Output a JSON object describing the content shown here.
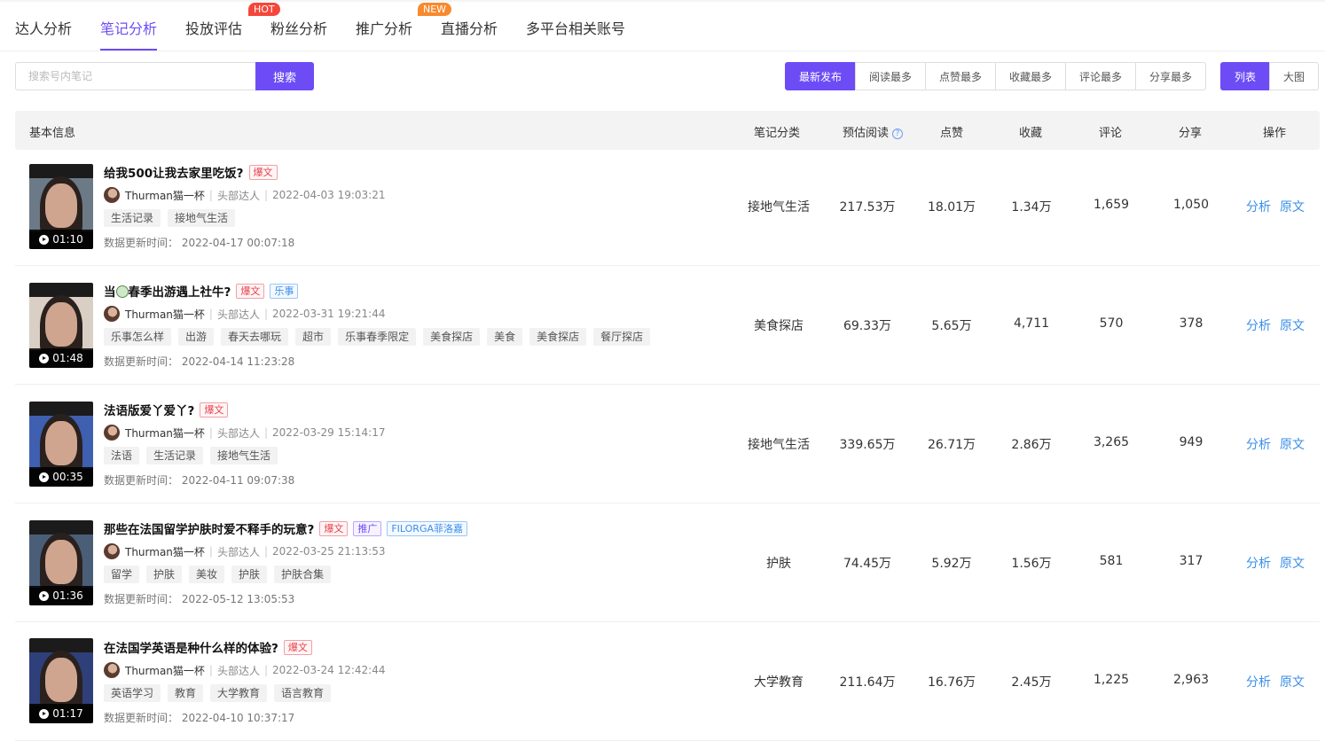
{
  "nav": {
    "tabs": [
      {
        "label": "达人分析"
      },
      {
        "label": "笔记分析"
      },
      {
        "label": "投放评估"
      },
      {
        "label": "粉丝分析"
      },
      {
        "label": "推广分析"
      },
      {
        "label": "直播分析"
      },
      {
        "label": "多平台相关账号"
      }
    ],
    "active_tab": "笔记分析",
    "badge_hot": "HOT",
    "badge_new": "NEW",
    "accent_color": "#6d4cf6"
  },
  "search": {
    "placeholder": "搜索号内笔记",
    "value": "",
    "button_label": "搜索"
  },
  "sort": {
    "options": [
      "最新发布",
      "阅读最多",
      "点赞最多",
      "收藏最多",
      "评论最多",
      "分享最多"
    ],
    "active": "最新发布"
  },
  "view": {
    "options": [
      "列表",
      "大图"
    ],
    "active": "列表"
  },
  "table": {
    "headers": {
      "basic": "基本信息",
      "category": "笔记分类",
      "reads": "预估阅读",
      "likes": "点赞",
      "collects": "收藏",
      "comments": "评论",
      "shares": "分享",
      "actions": "操作"
    },
    "help_icon": "question-circle-icon",
    "rows": [
      {
        "duration": "01:10",
        "title": "给我500让我去家里吃饭?",
        "tags": [
          {
            "text": "爆文",
            "color": "red"
          }
        ],
        "author": "Thurman猫一杯",
        "level": "头部达人",
        "published": "2022-04-03 19:03:21",
        "keywords": [
          "生活记录",
          "接地气生活"
        ],
        "updated_label": "数据更新时间：",
        "updated": "2022-04-17 00:07:18",
        "category": "接地气生活",
        "reads": "217.53万",
        "likes": "18.01万",
        "collects": "1.34万",
        "comments": "1,659",
        "shares": "1,050",
        "action_analyze": "分析",
        "action_original": "原文"
      },
      {
        "duration": "01:48",
        "title_prefix": "当",
        "title": "春季出游遇上社牛?",
        "tags": [
          {
            "text": "爆文",
            "color": "red"
          },
          {
            "text": "乐事",
            "color": "blue"
          }
        ],
        "author": "Thurman猫一杯",
        "level": "头部达人",
        "published": "2022-03-31 19:21:44",
        "keywords": [
          "乐事怎么样",
          "出游",
          "春天去哪玩",
          "超市",
          "乐事春季限定",
          "美食探店",
          "美食",
          "美食探店",
          "餐厅探店"
        ],
        "updated_label": "数据更新时间：",
        "updated": "2022-04-14 11:23:28",
        "category": "美食探店",
        "reads": "69.33万",
        "likes": "5.65万",
        "collects": "4,711",
        "comments": "570",
        "shares": "378",
        "action_analyze": "分析",
        "action_original": "原文"
      },
      {
        "duration": "00:35",
        "title": "法语版爱丫爱丫?",
        "tags": [
          {
            "text": "爆文",
            "color": "red"
          }
        ],
        "author": "Thurman猫一杯",
        "level": "头部达人",
        "published": "2022-03-29 15:14:17",
        "keywords": [
          "法语",
          "生活记录",
          "接地气生活"
        ],
        "updated_label": "数据更新时间：",
        "updated": "2022-04-11 09:07:38",
        "category": "接地气生活",
        "reads": "339.65万",
        "likes": "26.71万",
        "collects": "2.86万",
        "comments": "3,265",
        "shares": "949",
        "action_analyze": "分析",
        "action_original": "原文"
      },
      {
        "duration": "01:36",
        "title": "那些在法国留学护肤时爱不释手的玩意?",
        "tags": [
          {
            "text": "爆文",
            "color": "red"
          },
          {
            "text": "推广",
            "color": "purple"
          },
          {
            "text": "FILORGA菲洛嘉",
            "color": "blue"
          }
        ],
        "author": "Thurman猫一杯",
        "level": "头部达人",
        "published": "2022-03-25 21:13:53",
        "keywords": [
          "留学",
          "护肤",
          "美妆",
          "护肤",
          "护肤合集"
        ],
        "updated_label": "数据更新时间：",
        "updated": "2022-05-12 13:05:53",
        "category": "护肤",
        "reads": "74.45万",
        "likes": "5.92万",
        "collects": "1.56万",
        "comments": "581",
        "shares": "317",
        "action_analyze": "分析",
        "action_original": "原文"
      },
      {
        "duration": "01:17",
        "title": "在法国学英语是种什么样的体验?",
        "tags": [
          {
            "text": "爆文",
            "color": "red"
          }
        ],
        "author": "Thurman猫一杯",
        "level": "头部达人",
        "published": "2022-03-24 12:42:44",
        "keywords": [
          "英语学习",
          "教育",
          "大学教育",
          "语言教育"
        ],
        "updated_label": "数据更新时间：",
        "updated": "2022-04-10 10:37:17",
        "category": "大学教育",
        "reads": "211.64万",
        "likes": "16.76万",
        "collects": "2.45万",
        "comments": "1,225",
        "shares": "2,963",
        "action_analyze": "分析",
        "action_original": "原文"
      }
    ]
  }
}
